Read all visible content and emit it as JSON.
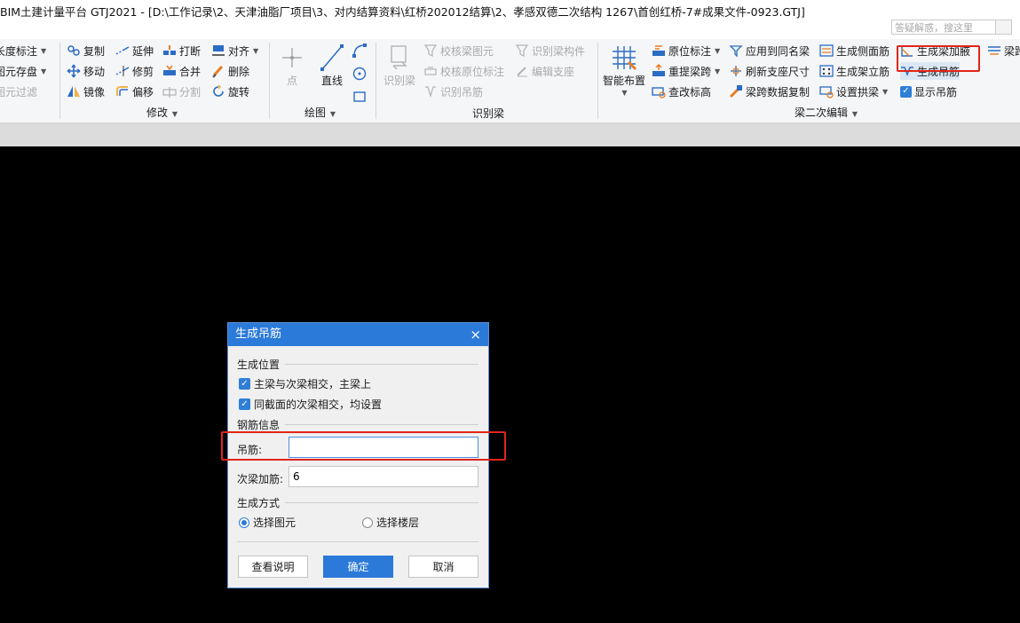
{
  "window": {
    "title": "BIM土建计量平台 GTJ2021 - [D:\\工作记录\\2、天津油脂厂项目\\3、对内结算资料\\红桥202012结算\\2、孝感双德二次结构 1267\\首创红桥-7#成果文件-0923.GTJ]",
    "search_placeholder": "答疑解惑，搜这里"
  },
  "ribbon": {
    "left_col": [
      {
        "label": "长度标注",
        "icon": "dimension-icon",
        "dropdown": true,
        "disabled": false
      },
      {
        "label": "图元存盘",
        "icon": "save-element-icon",
        "dropdown": true,
        "disabled": false
      },
      {
        "label": "图元过滤",
        "icon": "filter-icon",
        "dropdown": false,
        "disabled": true
      }
    ],
    "modify": {
      "label": "修改",
      "items": [
        {
          "label": "复制",
          "icon": "copy-icon"
        },
        {
          "label": "延伸",
          "icon": "extend-icon"
        },
        {
          "label": "打断",
          "icon": "break-icon"
        },
        {
          "label": "对齐",
          "icon": "align-icon"
        },
        {
          "label": "移动",
          "icon": "move-icon"
        },
        {
          "label": "修剪",
          "icon": "trim-icon"
        },
        {
          "label": "合并",
          "icon": "merge-icon"
        },
        {
          "label": "删除",
          "icon": "delete-icon"
        },
        {
          "label": "镜像",
          "icon": "mirror-icon"
        },
        {
          "label": "偏移",
          "icon": "offset-icon"
        },
        {
          "label": "分割",
          "icon": "split-icon"
        },
        {
          "label": "旋转",
          "icon": "rotate-icon"
        }
      ]
    },
    "draw": {
      "label": "绘图",
      "point": "点",
      "line": "直线"
    },
    "identify": {
      "label": "识别梁",
      "main": "识别梁",
      "items": [
        {
          "label": "校核梁图元"
        },
        {
          "label": "识别梁构件"
        },
        {
          "label": "校核原位标注"
        },
        {
          "label": "编辑支座"
        },
        {
          "label": "识别吊筋"
        }
      ]
    },
    "secondary": {
      "label": "梁二次编辑",
      "smart": "智能布置",
      "col1": [
        "原位标注",
        "重提梁跨",
        "查改标高"
      ],
      "col2": [
        "应用到同名梁",
        "刷新支座尺寸",
        "梁跨数据复制"
      ],
      "col3": [
        "生成侧面筋",
        "生成架立筋",
        "设置拱梁"
      ],
      "col4": [
        "生成梁加腋",
        "生成吊筋",
        "显示吊筋"
      ],
      "col5": "梁跨"
    }
  },
  "dialog": {
    "title": "生成吊筋",
    "close": "×",
    "position_section": "生成位置",
    "check1": "主梁与次梁相交，主梁上",
    "check2": "同截面的次梁相交，均设置",
    "rebar_section": "钢筋信息",
    "hanger_label": "吊筋:",
    "hanger_value": "",
    "secondary_label": "次梁加筋:",
    "secondary_value": "6",
    "method_section": "生成方式",
    "radio1": "选择图元",
    "radio2": "选择楼层",
    "btn_help": "查看说明",
    "btn_ok": "确定",
    "btn_cancel": "取消"
  },
  "colors": {
    "accent": "#2b7ad9",
    "highlight": "#e1251b",
    "canvas": "#000000"
  }
}
